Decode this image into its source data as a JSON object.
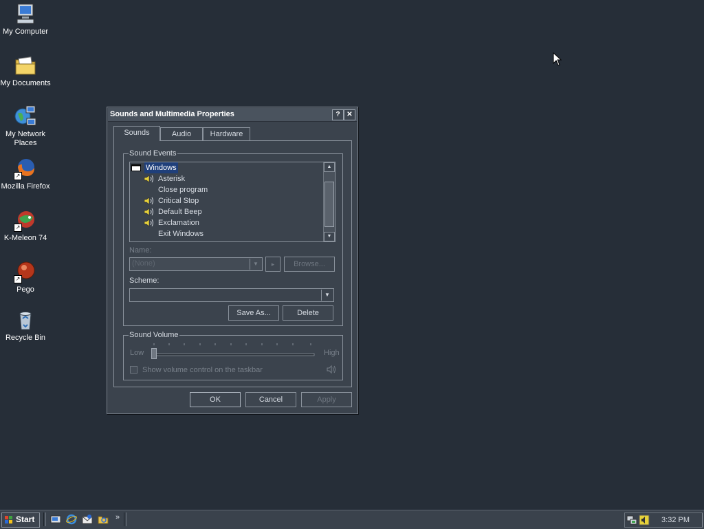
{
  "desktop": {
    "icons": [
      {
        "label": "My Computer",
        "icon": "computer-icon"
      },
      {
        "label": "My Documents",
        "icon": "folder-documents-icon"
      },
      {
        "label": "My Network Places",
        "icon": "network-icon"
      },
      {
        "label": "Mozilla Firefox",
        "icon": "firefox-icon"
      },
      {
        "label": "K-Meleon 74",
        "icon": "k-meleon-icon"
      },
      {
        "label": "Pego",
        "icon": "pego-icon"
      },
      {
        "label": "Recycle Bin",
        "icon": "recycle-bin-icon"
      }
    ]
  },
  "dialog": {
    "title": "Sounds and Multimedia Properties",
    "help_button": "?",
    "close_button": "✕",
    "tabs": [
      {
        "label": "Sounds",
        "active": true
      },
      {
        "label": "Audio",
        "active": false
      },
      {
        "label": "Hardware",
        "active": false
      }
    ],
    "sound_events": {
      "group_label": "Sound Events",
      "items": [
        {
          "label": "Windows",
          "type": "folder",
          "selected": true
        },
        {
          "label": "Asterisk",
          "has_sound": true
        },
        {
          "label": "Close program",
          "has_sound": false
        },
        {
          "label": "Critical Stop",
          "has_sound": true
        },
        {
          "label": "Default Beep",
          "has_sound": true
        },
        {
          "label": "Exclamation",
          "has_sound": true
        },
        {
          "label": "Exit Windows",
          "has_sound": false
        }
      ]
    },
    "name_label": "Name:",
    "name_value": "(None)",
    "browse_label": "Browse...",
    "scheme_label": "Scheme:",
    "scheme_value": "",
    "save_as_label": "Save As...",
    "delete_label": "Delete",
    "volume": {
      "group_label": "Sound Volume",
      "low_label": "Low",
      "high_label": "High",
      "level_fraction": 0.0,
      "show_volume_label": "Show volume control on the taskbar",
      "show_volume_checked": false
    },
    "ok_label": "OK",
    "cancel_label": "Cancel",
    "apply_label": "Apply"
  },
  "taskbar": {
    "start_label": "Start",
    "quick_launch": [
      "show-desktop-icon",
      "internet-explorer-icon",
      "outlook-express-icon",
      "windows-explorer-icon"
    ],
    "overflow": "»",
    "clock": "3:32 PM",
    "tray_icons": [
      "network-tray-icon",
      "volume-tray-icon"
    ]
  }
}
